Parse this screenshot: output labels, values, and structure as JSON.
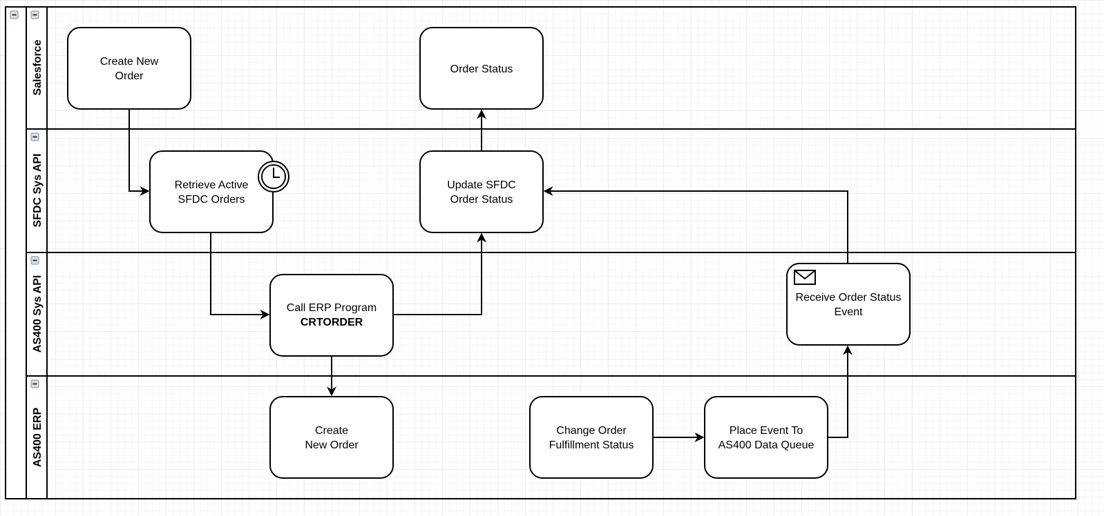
{
  "pool": {
    "collapse_icon": "minus-box-icon"
  },
  "lanes": [
    {
      "title": "Salesforce"
    },
    {
      "title": "SFDC Sys API"
    },
    {
      "title": "AS400 Sys API"
    },
    {
      "title": "AS400 ERP"
    }
  ],
  "nodes": {
    "create_order_sf": {
      "lines": [
        "Create New",
        "Order"
      ]
    },
    "order_status": {
      "lines": [
        "Order Status"
      ]
    },
    "retrieve": {
      "lines": [
        "Retrieve Active",
        "SFDC Orders"
      ],
      "icon": "timer-clock-icon"
    },
    "update_sfdc": {
      "lines": [
        "Update SFDC",
        "Order Status"
      ]
    },
    "call_erp": {
      "lines": [
        "Call ERP Program",
        "CRTORDER"
      ]
    },
    "receive": {
      "lines": [
        "Receive Order Status",
        "Event"
      ],
      "icon": "envelope-icon"
    },
    "create_order_erp": {
      "lines": [
        "Create",
        "New Order"
      ]
    },
    "change_status": {
      "lines": [
        "Change Order",
        "Fulfillment Status"
      ]
    },
    "place_event": {
      "lines": [
        "Place Event To",
        "AS400 Data Queue"
      ]
    }
  }
}
